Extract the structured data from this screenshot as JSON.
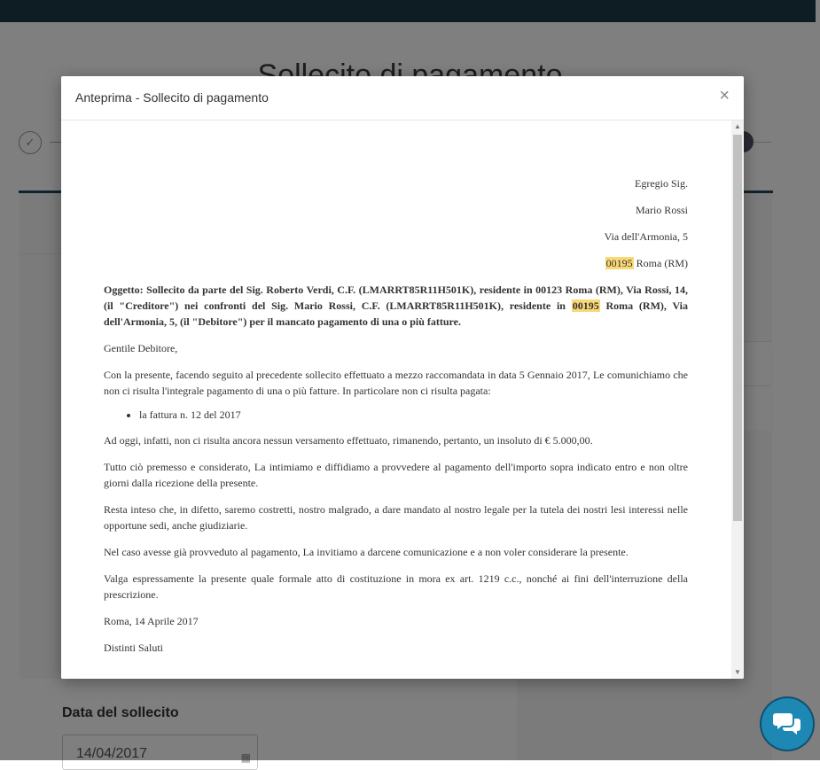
{
  "background": {
    "page_title": "Sollecito di pagamento",
    "step_done_icon": "✓",
    "date_label": "Data del sollecito",
    "date_value": "14/04/2017"
  },
  "modal": {
    "title": "Anteprima - Sollecito di pagamento",
    "close_label": "×"
  },
  "letter": {
    "salutation": "Egregio Sig.",
    "recipient_name": "Mario Rossi",
    "recipient_street": "Via dell'Armonia, 5",
    "recipient_cap": "00195",
    "recipient_city": " Roma (RM)",
    "subject_part1": "Oggetto: Sollecito da parte del Sig. Roberto Verdi, C.F. (LMARRT85R11H501K), residente in 00123 Roma (RM), Via Rossi, 14,  (il \"Creditore\") nei confronti del Sig. Mario Rossi, C.F. (LMARRT85R11H501K), residente in ",
    "subject_cap": "00195",
    "subject_part2": " Roma (RM), Via dell'Armonia, 5,  (il \"Debitore\") per il mancato pagamento di una o più fatture.",
    "greeting": "Gentile Debitore,",
    "para1": "Con la presente, facendo seguito al precedente sollecito effettuato a mezzo raccomandata  in data 5 Gennaio 2017, Le comunichiamo che non ci risulta l'integrale pagamento di una o più fatture. In particolare non ci risulta pagata:",
    "invoices": [
      "la fattura n. 12 del 2017"
    ],
    "para2": "Ad oggi, infatti, non ci risulta ancora nessun versamento effettuato, rimanendo, pertanto, un insoluto di € 5.000,00.",
    "para3": "Tutto ciò premesso e considerato, La intimiamo e diffidiamo a provvedere al pagamento dell'importo sopra indicato entro e non oltre giorni dalla ricezione della presente.",
    "para4": "Resta inteso che, in difetto, saremo costretti, nostro malgrado, a dare mandato al nostro legale per la tutela dei nostri lesi interessi nelle opportune sedi, anche giudiziarie.",
    "para5": "Nel caso avesse già provveduto al pagamento, La invitiamo a darcene comunicazione e a non voler considerare la presente.",
    "para6": "Valga espressamente la presente quale formale atto di costituzione in mora ex art. 1219 c.c., nonché ai fini dell'interruzione della prescrizione.",
    "place_date": "Roma, 14 Aprile 2017",
    "closing": "Distinti Saluti"
  },
  "colors": {
    "topbar": "#1d3a48",
    "highlight": "#f9d976",
    "chat": "#1e88b4"
  },
  "icons": {
    "close": "close-icon",
    "chat": "chat-icon",
    "calendar": "calendar-icon"
  }
}
